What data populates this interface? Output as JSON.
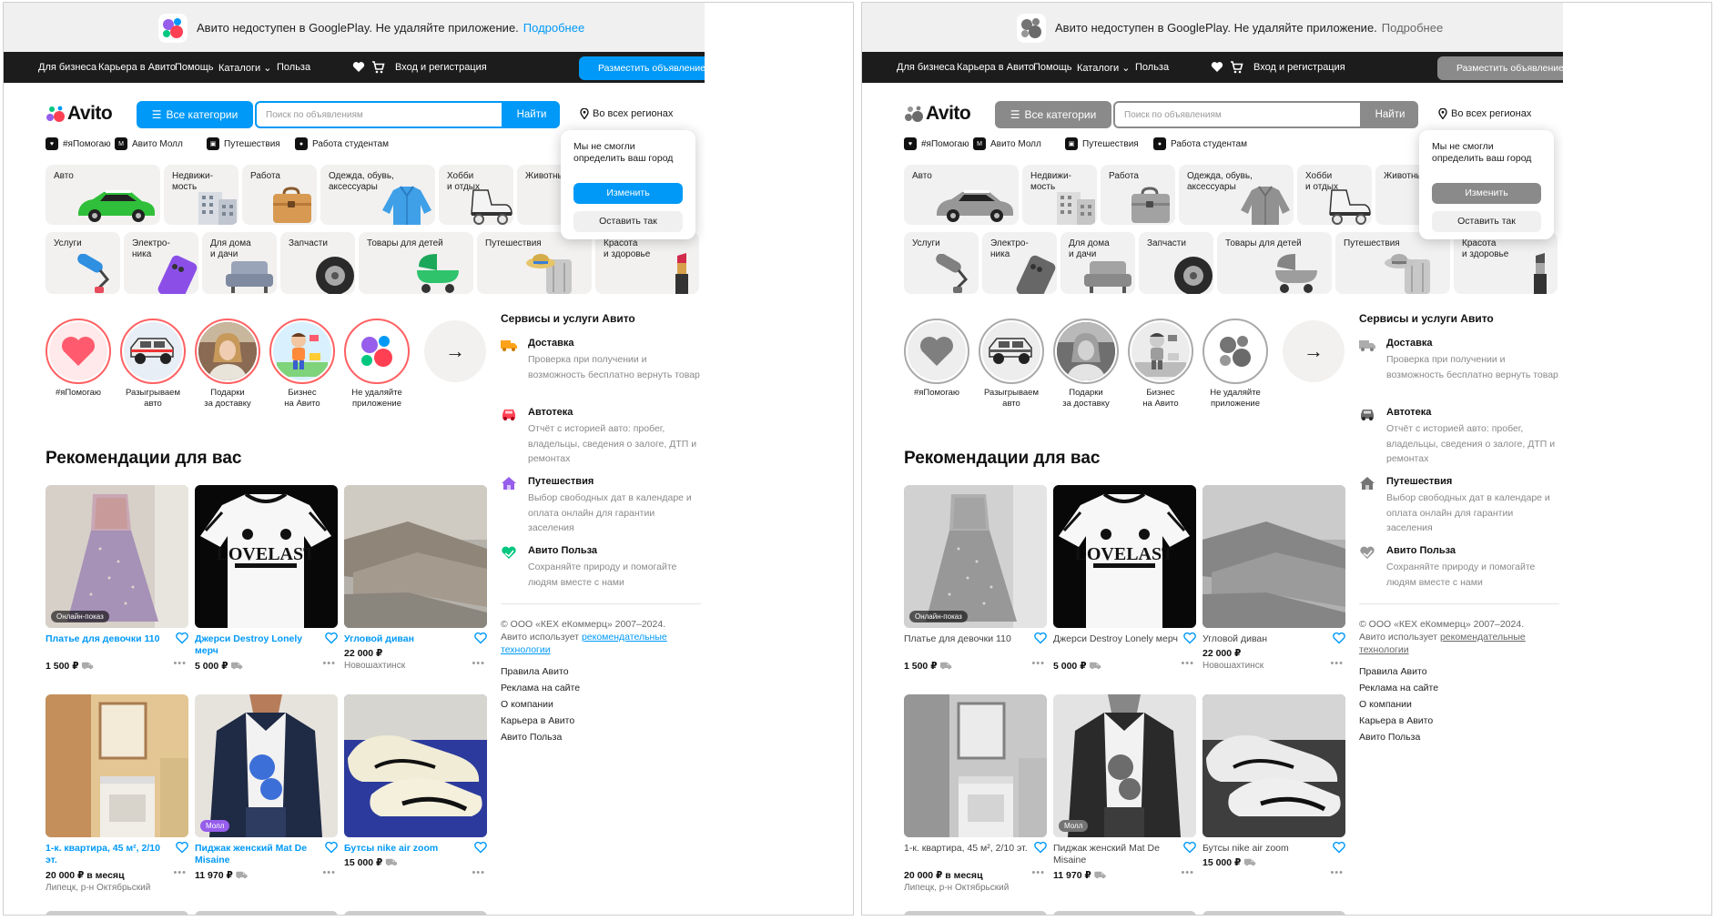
{
  "banner": {
    "text": "Авито недоступен в GooglePlay. Не удаляйте приложение.",
    "link": "Подробнее"
  },
  "topnav": {
    "items": [
      "Для бизнеса",
      "Карьера в Авито",
      "Помощь",
      "Каталоги",
      "Польза"
    ],
    "login": "Вход и регистрация",
    "post_ad": "Разместить объявление"
  },
  "header": {
    "logo": "Avito",
    "all_categories": "Все категории",
    "search_placeholder": "Поиск по объявлениям",
    "search_button": "Найти",
    "region": "Во всех регионах"
  },
  "quicklinks": [
    "#яПомогаю",
    "Авито Молл",
    "Путешествия",
    "Работа студентам"
  ],
  "categories_row1": [
    "Авто",
    "Недвижи-\nмость",
    "Работа",
    "Одежда, обувь,\nаксессуары",
    "Хобби\nи отдых",
    "Животные"
  ],
  "categories_row2": [
    "Услуги",
    "Электро-\nника",
    "Для дома\nи дачи",
    "Запчасти",
    "Товары для детей",
    "Путешествия",
    "Красота\nи здоровье"
  ],
  "city_popup": {
    "text": "Мы не смогли определить ваш город",
    "change": "Изменить",
    "keep": "Оставить так"
  },
  "stories": [
    "#яПомогаю",
    "Разыгрываем\nавто",
    "Подарки\nза доставку",
    "Бизнес\nна Авито",
    "Не удаляйте\nприложение"
  ],
  "services": {
    "title": "Сервисы и услуги Авито",
    "items": [
      {
        "title": "Доставка",
        "desc": "Проверка при получении и возможность бесплатно вернуть товар"
      },
      {
        "title": "Автотека",
        "desc": "Отчёт с историей авто: пробег, владельцы, сведения о залоге, ДТП и ремонтах"
      },
      {
        "title": "Путешествия",
        "desc": "Выбор свободных дат в календаре и оплата онлайн для гарантии заселения"
      },
      {
        "title": "Авито Польза",
        "desc": "Сохраняйте природу и помогайте людям вместе с нами"
      }
    ]
  },
  "footer": {
    "copyright": "© ООО «КЕХ еКоммерц» 2007–2024.",
    "uses": "Авито использует",
    "tech_link": "рекомендательные технологии",
    "links": [
      "Правила Авито",
      "Реклама на сайте",
      "О компании",
      "Карьера в Авито",
      "Авито Польза"
    ]
  },
  "recommendations": {
    "title": "Рекомендации для вас",
    "cards": [
      {
        "title": "Платье для девочки 110",
        "price": "1 500 ₽",
        "location": "",
        "badge": "Онлайн-показ"
      },
      {
        "title": "Джерси Destroy Lonely мерч",
        "price": "5 000 ₽",
        "location": "",
        "badge": ""
      },
      {
        "title": "Угловой диван",
        "price": "22 000 ₽",
        "location": "Новошахтинск",
        "badge": ""
      },
      {
        "title": "1-к. квартира, 45 м², 2/10 эт.",
        "price": "20 000 ₽ в месяц",
        "location": "Липецк, р-н Октябрьский",
        "badge": ""
      },
      {
        "title": "Пиджак женский Mat De Misaine",
        "price": "11 970 ₽",
        "location": "",
        "badge": "Молл"
      },
      {
        "title": "Бутсы nike air zoom",
        "price": "15 000 ₽",
        "location": "",
        "badge": ""
      }
    ]
  },
  "colors": {
    "accent": "#0099f7",
    "nav_bg": "#1c1c1c",
    "story_ring": "#ff6163"
  }
}
